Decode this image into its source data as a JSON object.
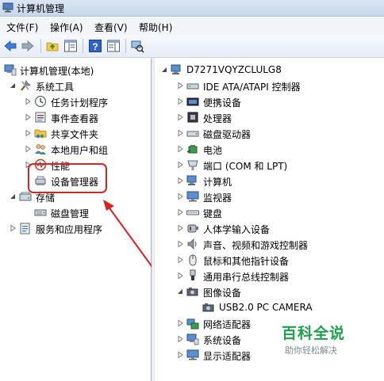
{
  "window": {
    "title": "计算机管理"
  },
  "menu": [
    "文件(F)",
    "操作(A)",
    "查看(V)",
    "帮助(H)"
  ],
  "toolbar": {
    "buttons": [
      "back-arrow-icon",
      "forward-arrow-icon",
      "folder-up-icon",
      "show-hide-tree-icon",
      "help-icon",
      "properties-panel-icon",
      "scan-hardware-icon"
    ]
  },
  "left_tree": [
    {
      "label": "计算机管理(本地)",
      "icon": "computer-management-icon",
      "expander": "none"
    },
    {
      "label": "系统工具",
      "icon": "tools-icon",
      "expander": "expanded"
    },
    {
      "label": "任务计划程序",
      "icon": "clock-icon",
      "expander": "collapsed"
    },
    {
      "label": "事件查看器",
      "icon": "event-viewer-icon",
      "expander": "collapsed"
    },
    {
      "label": "共享文件夹",
      "icon": "shared-folder-icon",
      "expander": "collapsed"
    },
    {
      "label": "本地用户和组",
      "icon": "users-icon",
      "expander": "collapsed"
    },
    {
      "label": "性能",
      "icon": "performance-icon",
      "expander": "collapsed"
    },
    {
      "label": "设备管理器",
      "icon": "device-manager-icon",
      "expander": "none"
    },
    {
      "label": "存储",
      "icon": "storage-icon",
      "expander": "expanded"
    },
    {
      "label": "磁盘管理",
      "icon": "disk-management-icon",
      "expander": "none"
    },
    {
      "label": "服务和应用程序",
      "icon": "services-icon",
      "expander": "collapsed"
    }
  ],
  "device_tree": {
    "root": {
      "label": "D7271VQYZCLULG8",
      "icon": "computer-icon"
    },
    "items": [
      {
        "label": "IDE ATA/ATAPI 控制器",
        "icon": "ide-controller-icon",
        "expander": "collapsed"
      },
      {
        "label": "便携设备",
        "icon": "portable-device-icon",
        "expander": "collapsed"
      },
      {
        "label": "处理器",
        "icon": "processor-icon",
        "expander": "collapsed"
      },
      {
        "label": "磁盘驱动器",
        "icon": "disk-drive-icon",
        "expander": "collapsed"
      },
      {
        "label": "电池",
        "icon": "battery-icon",
        "expander": "collapsed"
      },
      {
        "label": "端口 (COM 和 LPT)",
        "icon": "port-icon",
        "expander": "collapsed"
      },
      {
        "label": "计算机",
        "icon": "computer-icon",
        "expander": "collapsed"
      },
      {
        "label": "监视器",
        "icon": "monitor-icon",
        "expander": "collapsed"
      },
      {
        "label": "键盘",
        "icon": "keyboard-icon",
        "expander": "collapsed"
      },
      {
        "label": "人体学输入设备",
        "icon": "hid-icon",
        "expander": "collapsed"
      },
      {
        "label": "声音、视频和游戏控制器",
        "icon": "sound-icon",
        "expander": "collapsed"
      },
      {
        "label": "鼠标和其他指针设备",
        "icon": "mouse-icon",
        "expander": "collapsed"
      },
      {
        "label": "通用串行总线控制器",
        "icon": "usb-icon",
        "expander": "collapsed"
      },
      {
        "label": "图像设备",
        "icon": "imaging-device-icon",
        "expander": "expanded"
      },
      {
        "label": "USB2.0 PC CAMERA",
        "icon": "camera-icon",
        "expander": "none"
      },
      {
        "label": "网络适配器",
        "icon": "network-adapter-icon",
        "expander": "collapsed"
      },
      {
        "label": "系统设备",
        "icon": "system-device-icon",
        "expander": "collapsed"
      },
      {
        "label": "显示适配器",
        "icon": "display-adapter-icon",
        "expander": "collapsed"
      }
    ]
  },
  "watermark": {
    "main": "百科全说",
    "sub": "助你轻松解决"
  },
  "colors": {
    "highlight": "#d62424",
    "watermark": "#1f9f4a",
    "titlebar": "#dbe6f3"
  }
}
